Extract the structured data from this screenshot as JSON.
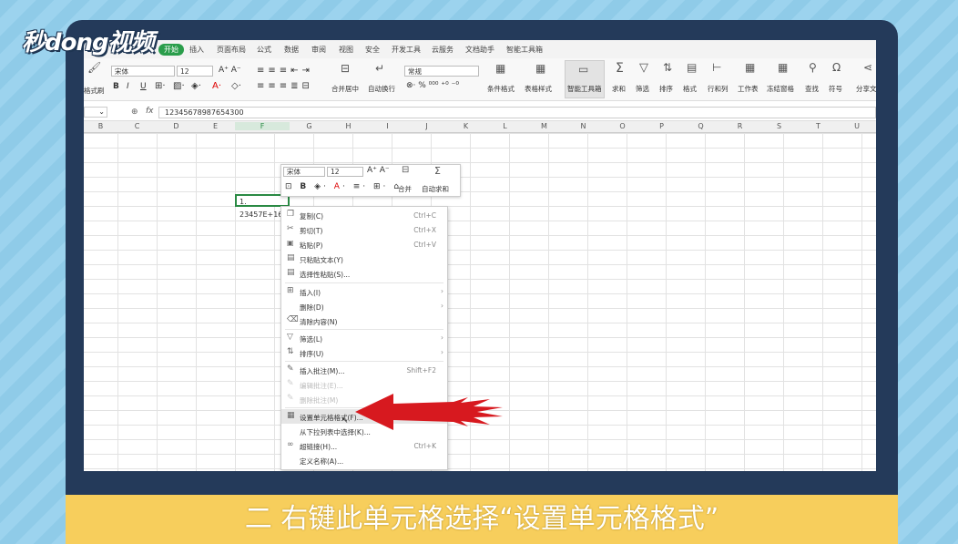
{
  "video": {
    "logo": "秒dong视频",
    "caption": "二 右键此单元格选择“设置单元格格式”"
  },
  "menu": {
    "tabs": [
      "开始",
      "插入",
      "页面布局",
      "公式",
      "数据",
      "审阅",
      "视图",
      "安全",
      "开发工具",
      "云服务",
      "文档助手",
      "智能工具箱"
    ],
    "active": "开始"
  },
  "ribbon": {
    "format_painter": "格式刷",
    "font_name": "宋体",
    "font_size": "12",
    "merge": "合并居中",
    "wrap": "自动换行",
    "number_format": "常规",
    "cond_format": "条件格式",
    "table_style": "表格样式",
    "smart_toolbox": "智能工具箱",
    "sum": "求和",
    "filter": "筛选",
    "sort": "排序",
    "format": "格式",
    "rowcol": "行和列",
    "sheet": "工作表",
    "freeze": "冻结窗格",
    "find": "查找",
    "symbol": "符号",
    "share": "分享文"
  },
  "formula_bar": {
    "fx": "fx",
    "value": "12345678987654300"
  },
  "columns": [
    "B",
    "C",
    "D",
    "E",
    "F",
    "G",
    "H",
    "I",
    "J",
    "K",
    "L",
    "M",
    "N",
    "O",
    "P",
    "Q",
    "R",
    "S",
    "T",
    "U"
  ],
  "active_cell": {
    "value": "1. 23457E+16"
  },
  "mini_toolbar": {
    "font": "宋体",
    "size": "12",
    "merge": "合并",
    "autosum": "自动求和"
  },
  "context_menu": {
    "items": [
      {
        "label": "复制(C)",
        "shortcut": "Ctrl+C",
        "icon": "copy-icon",
        "glyph": "❐"
      },
      {
        "label": "剪切(T)",
        "shortcut": "Ctrl+X",
        "icon": "cut-icon",
        "glyph": "✂"
      },
      {
        "label": "粘贴(P)",
        "shortcut": "Ctrl+V",
        "icon": "paste-icon",
        "glyph": "📋"
      },
      {
        "label": "只粘贴文本(Y)",
        "shortcut": "",
        "icon": "paste-text-icon",
        "glyph": "▤"
      },
      {
        "label": "选择性粘贴(S)...",
        "shortcut": "",
        "icon": "paste-special-icon",
        "glyph": "▤"
      },
      {
        "label": "插入(I)",
        "shortcut": "",
        "icon": "insert-icon",
        "glyph": "⊞",
        "submenu": true
      },
      {
        "label": "删除(D)",
        "shortcut": "",
        "icon": "",
        "glyph": "",
        "submenu": true
      },
      {
        "label": "清除内容(N)",
        "shortcut": "",
        "icon": "clear-icon",
        "glyph": "⌫"
      },
      {
        "label": "筛选(L)",
        "shortcut": "",
        "icon": "filter-icon",
        "glyph": "▽",
        "submenu": true
      },
      {
        "label": "排序(U)",
        "shortcut": "",
        "icon": "sort-icon",
        "glyph": "⇅",
        "submenu": true
      },
      {
        "label": "插入批注(M)...",
        "shortcut": "Shift+F2",
        "icon": "comment-icon",
        "glyph": "✎"
      },
      {
        "label": "编辑批注(E)...",
        "shortcut": "",
        "icon": "edit-comment-icon",
        "glyph": "✎",
        "disabled": true
      },
      {
        "label": "删除批注(M)",
        "shortcut": "",
        "icon": "delete-comment-icon",
        "glyph": "✎",
        "disabled": true
      },
      {
        "label": "设置单元格格式(F)...",
        "shortcut": "",
        "icon": "format-cells-icon",
        "glyph": "▦",
        "highlight": true
      },
      {
        "label": "从下拉列表中选择(K)...",
        "shortcut": "",
        "icon": "",
        "glyph": ""
      },
      {
        "label": "超链接(H)...",
        "shortcut": "Ctrl+K",
        "icon": "link-icon",
        "glyph": "🔗"
      },
      {
        "label": "定义名称(A)...",
        "shortcut": "",
        "icon": "",
        "glyph": ""
      }
    ]
  },
  "colors": {
    "accent": "#2a9d4b",
    "arrow": "#d7191f",
    "frame": "#243a5a",
    "caption_bar": "#f7ce5c"
  }
}
